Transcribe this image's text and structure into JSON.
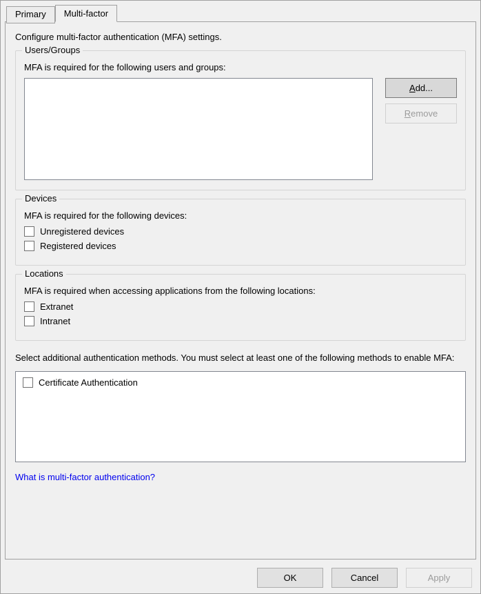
{
  "tabs": {
    "primary": "Primary",
    "multifactor": "Multi-factor"
  },
  "description": "Configure multi-factor authentication (MFA) settings.",
  "usersGroups": {
    "legend": "Users/Groups",
    "label": "MFA is required for the following users and groups:",
    "addBtn": "Add...",
    "addAccel": "A",
    "removeBtn": "Remove",
    "removeAccel": "R"
  },
  "devices": {
    "legend": "Devices",
    "label": "MFA is required for the following devices:",
    "options": [
      "Unregistered devices",
      "Registered devices"
    ]
  },
  "locations": {
    "legend": "Locations",
    "label": "MFA is required when accessing applications from the following locations:",
    "options": [
      "Extranet",
      "Intranet"
    ]
  },
  "methods": {
    "label": "Select additional authentication methods. You must select at least one of the following methods to enable MFA:",
    "options": [
      "Certificate Authentication"
    ]
  },
  "helpLink": "What is multi-factor authentication?",
  "footer": {
    "ok": "OK",
    "cancel": "Cancel",
    "apply": "Apply"
  }
}
